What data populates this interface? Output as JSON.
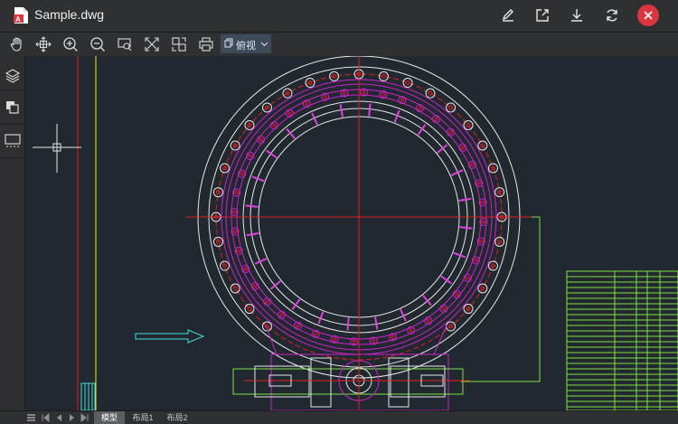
{
  "window": {
    "title": "Sample.dwg",
    "file_icon": "autocad-file-icon",
    "actions": [
      "edit-icon",
      "share-icon",
      "download-icon",
      "refresh-icon",
      "close-icon"
    ]
  },
  "toolbar": {
    "tools": [
      "pan-icon",
      "fit-view-icon",
      "zoom-in-icon",
      "zoom-out-icon",
      "zoom-window-icon",
      "measure-icon",
      "compare-icon",
      "print-icon"
    ],
    "view_label": "俯视"
  },
  "sidebar": {
    "buttons": [
      "layers-icon",
      "blocks-icon",
      "layout-icon"
    ]
  },
  "layout_tabs": [
    "模型",
    "布局1",
    "布局2"
  ],
  "active_tab": "模型",
  "colors": {
    "background": "#212830",
    "accent": "#d9363e",
    "drawing_magenta": "#cc22cc",
    "drawing_red": "#e02020",
    "drawing_green": "#80e040",
    "drawing_yellow": "#f0f000",
    "drawing_cyan": "#40e0e0"
  }
}
